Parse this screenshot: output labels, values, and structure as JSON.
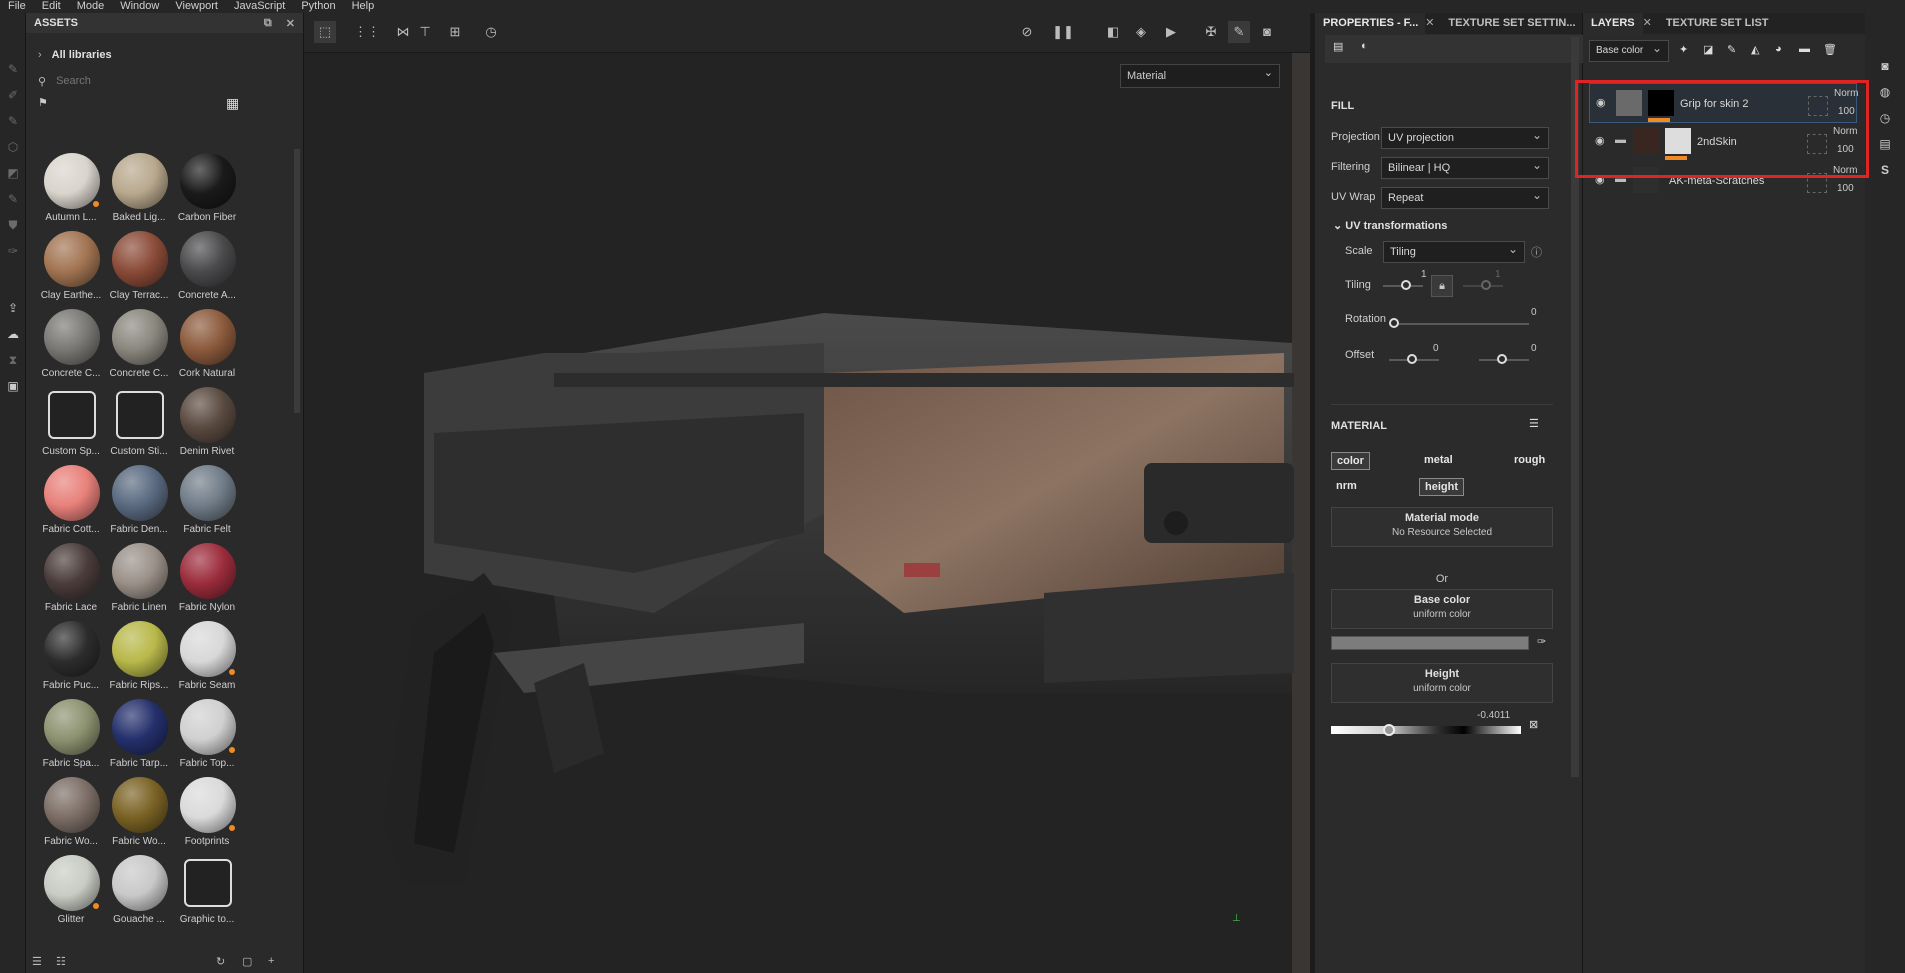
{
  "menu": [
    "File",
    "Edit",
    "Mode",
    "Window",
    "Viewport",
    "JavaScript",
    "Python",
    "Help"
  ],
  "assets": {
    "title": "ASSETS",
    "all_libraries": "All libraries",
    "search_placeholder": "Search",
    "items": [
      {
        "label": "Autumn L...",
        "color": "#d9d4cc",
        "dot": true
      },
      {
        "label": "Baked Lig...",
        "color": "#b8a88d",
        "dot": false
      },
      {
        "label": "Carbon Fiber",
        "color": "#1a1a1a",
        "dot": false
      },
      {
        "label": "Clay Earthe...",
        "color": "#a27452",
        "dot": false
      },
      {
        "label": "Clay Terrac...",
        "color": "#8b4b38",
        "dot": false
      },
      {
        "label": "Concrete A...",
        "color": "#4a4a4c",
        "dot": false
      },
      {
        "label": "Concrete C...",
        "color": "#7a7874",
        "dot": false
      },
      {
        "label": "Concrete C...",
        "color": "#8a877e",
        "dot": false
      },
      {
        "label": "Cork Natural",
        "color": "#8c5a3c",
        "dot": false
      },
      {
        "label": "Custom Sp...",
        "color": "",
        "dot": false
      },
      {
        "label": "Custom Sti...",
        "color": "",
        "dot": false
      },
      {
        "label": "Denim Rivet",
        "color": "#5a4a40",
        "dot": false
      },
      {
        "label": "Fabric Cott...",
        "color": "#e8807a",
        "dot": false
      },
      {
        "label": "Fabric Den...",
        "color": "#5a6a80",
        "dot": false
      },
      {
        "label": "Fabric Felt",
        "color": "#707c88",
        "dot": false
      },
      {
        "label": "Fabric Lace",
        "color": "#4a3c3a",
        "dot": false
      },
      {
        "label": "Fabric Linen",
        "color": "#9a9088",
        "dot": false
      },
      {
        "label": "Fabric Nylon",
        "color": "#9c2c3c",
        "dot": false
      },
      {
        "label": "Fabric Puc...",
        "color": "#2c2c2c",
        "dot": false
      },
      {
        "label": "Fabric Rips...",
        "color": "#b8b84a",
        "dot": false
      },
      {
        "label": "Fabric Seam",
        "color": "#d8d8d8",
        "dot": true
      },
      {
        "label": "Fabric Spa...",
        "color": "#8c9270",
        "dot": false
      },
      {
        "label": "Fabric Tarp...",
        "color": "#24306c",
        "dot": false
      },
      {
        "label": "Fabric Top...",
        "color": "#d0d0d0",
        "dot": true
      },
      {
        "label": "Fabric Wo...",
        "color": "#7c6e66",
        "dot": false
      },
      {
        "label": "Fabric Wo...",
        "color": "#7a6224",
        "dot": false
      },
      {
        "label": "Footprints",
        "color": "#dadada",
        "dot": true
      },
      {
        "label": "Glitter",
        "color": "#c8ccc4",
        "dot": true
      },
      {
        "label": "Gouache ...",
        "color": "#c8c8c8",
        "dot": false
      },
      {
        "label": "Graphic to...",
        "color": "",
        "dot": false
      }
    ]
  },
  "viewport": {
    "mode_select": "Material"
  },
  "properties": {
    "tabs": [
      "PROPERTIES - F...",
      "TEXTURE SET SETTIN..."
    ],
    "fill": "FILL",
    "projection_label": "Projection",
    "projection": "UV projection",
    "filtering_label": "Filtering",
    "filtering": "Bilinear | HQ",
    "uvwrap_label": "UV Wrap",
    "uvwrap": "Repeat",
    "uvtrans": "UV transformations",
    "scale_label": "Scale",
    "scale": "Tiling",
    "tiling_label": "Tiling",
    "tiling_u": "1",
    "tiling_v": "1",
    "rotation_label": "Rotation",
    "rotation": "0",
    "offset_label": "Offset",
    "offset_u": "0",
    "offset_v": "0",
    "material": "MATERIAL",
    "channels": {
      "color": "color",
      "metal": "metal",
      "rough": "rough",
      "nrm": "nrm",
      "height": "height"
    },
    "material_mode": "Material mode",
    "no_resource": "No Resource Selected",
    "or": "Or",
    "base_color": "Base color",
    "uniform1": "uniform color",
    "height": "Height",
    "uniform2": "uniform color",
    "height_value": "-0.4011"
  },
  "layers": {
    "tabs": [
      "LAYERS",
      "TEXTURE SET LIST"
    ],
    "channel_select": "Base color",
    "items": [
      {
        "name": "Grip for skin 2",
        "blend": "Norm",
        "opacity": "100"
      },
      {
        "name": "2ndSkin",
        "blend": "Norm",
        "opacity": "100"
      },
      {
        "name": "AK-meta-Scratches",
        "blend": "Norm",
        "opacity": "100"
      }
    ]
  },
  "colors": {
    "accent": "#f08a24",
    "highlight": "#e02424",
    "selected": "#2f4a6e"
  }
}
